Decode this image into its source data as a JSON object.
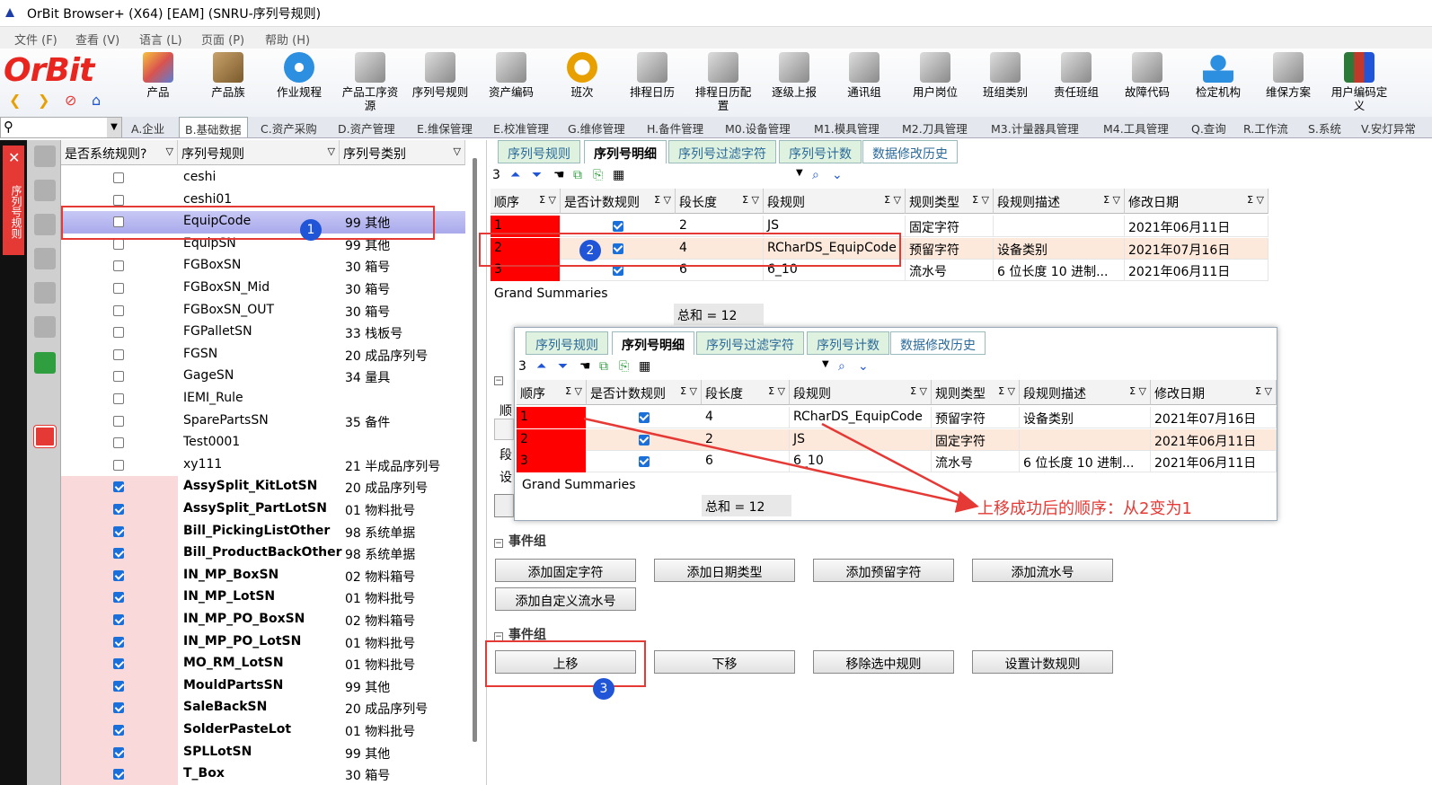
{
  "window": {
    "title": "OrBit Browser+ (X64) [EAM] (SNRU-序列号规则)"
  },
  "menu": [
    "文件 (F)",
    "查看 (V)",
    "语言 (L)",
    "页面 (P)",
    "帮助 (H)"
  ],
  "brand": "OrBit",
  "toolbar": [
    "产品",
    "产品族",
    "作业规程",
    "产品工序资源",
    "序列号规则",
    "资产编码",
    "班次",
    "排程日历",
    "排程日历配置",
    "逐级上报",
    "通讯组",
    "用户岗位",
    "班组类别",
    "责任班组",
    "故障代码",
    "检定机构",
    "维保方案",
    "用户编码定义"
  ],
  "module_tabs": [
    "A.企业",
    "B.基础数据",
    "C.资产采购",
    "D.资产管理",
    "E.维保管理",
    "E.校准管理",
    "G.维修管理",
    "H.备件管理",
    "M0.设备管理",
    "M1.模具管理",
    "M2.刀具管理",
    "M3.计量器具管理",
    "M4.工具管理",
    "Q.查询",
    "R.工作流",
    "S.系统",
    "V.安灯异常"
  ],
  "sidebar_label": "序列号规则",
  "left_grid": {
    "headers": [
      "是否系统规则?",
      "序列号规则",
      "序列号类别"
    ],
    "rows": [
      {
        "sys": false,
        "name": "ceshi",
        "cat": ""
      },
      {
        "sys": false,
        "name": "ceshi01",
        "cat": ""
      },
      {
        "sys": false,
        "name": "EquipCode",
        "cat": "99 其他",
        "selected": true
      },
      {
        "sys": false,
        "name": "EquipSN",
        "cat": "99 其他"
      },
      {
        "sys": false,
        "name": "FGBoxSN",
        "cat": "30 箱号"
      },
      {
        "sys": false,
        "name": "FGBoxSN_Mid",
        "cat": "30 箱号"
      },
      {
        "sys": false,
        "name": "FGBoxSN_OUT",
        "cat": "30 箱号"
      },
      {
        "sys": false,
        "name": "FGPalletSN",
        "cat": "33 栈板号"
      },
      {
        "sys": false,
        "name": "FGSN",
        "cat": "20 成品序列号"
      },
      {
        "sys": false,
        "name": "GageSN",
        "cat": "34 量具"
      },
      {
        "sys": false,
        "name": "IEMI_Rule",
        "cat": ""
      },
      {
        "sys": false,
        "name": "SparePartsSN",
        "cat": "35 备件"
      },
      {
        "sys": false,
        "name": "Test0001",
        "cat": ""
      },
      {
        "sys": false,
        "name": "xy111",
        "cat": "21 半成品序列号"
      },
      {
        "sys": true,
        "name": "AssySplit_KitLotSN",
        "cat": "20 成品序列号"
      },
      {
        "sys": true,
        "name": "AssySplit_PartLotSN",
        "cat": "01 物料批号"
      },
      {
        "sys": true,
        "name": "Bill_PickingListOther",
        "cat": "98 系统单据"
      },
      {
        "sys": true,
        "name": "Bill_ProductBackOther",
        "cat": "98 系统单据"
      },
      {
        "sys": true,
        "name": "IN_MP_BoxSN",
        "cat": "02 物料箱号"
      },
      {
        "sys": true,
        "name": "IN_MP_LotSN",
        "cat": "01 物料批号"
      },
      {
        "sys": true,
        "name": "IN_MP_PO_BoxSN",
        "cat": "02 物料箱号"
      },
      {
        "sys": true,
        "name": "IN_MP_PO_LotSN",
        "cat": "01 物料批号"
      },
      {
        "sys": true,
        "name": "MO_RM_LotSN",
        "cat": "01 物料批号"
      },
      {
        "sys": true,
        "name": "MouldPartsSN",
        "cat": "99 其他"
      },
      {
        "sys": true,
        "name": "SaleBackSN",
        "cat": "20 成品序列号"
      },
      {
        "sys": true,
        "name": "SolderPasteLot",
        "cat": "01 物料批号"
      },
      {
        "sys": true,
        "name": "SPLLotSN",
        "cat": "99 其他"
      },
      {
        "sys": true,
        "name": "T_Box",
        "cat": "30 箱号"
      }
    ]
  },
  "sub_tabs": [
    "序列号规则",
    "序列号明细",
    "序列号过滤字符",
    "序列号计数",
    "数据修改历史"
  ],
  "detail": {
    "count": "3",
    "headers": [
      "顺序",
      "是否计数规则",
      "段长度",
      "段规则",
      "规则类型",
      "段规则描述",
      "修改日期"
    ],
    "rows": [
      {
        "seq": "1",
        "len": "2",
        "rule": "JS",
        "type": "固定字符",
        "desc": "",
        "date": "2021年06月11日"
      },
      {
        "seq": "2",
        "len": "4",
        "rule": "RCharDS_EquipCode",
        "type": "预留字符",
        "desc": "设备类别",
        "date": "2021年07月16日"
      },
      {
        "seq": "3",
        "len": "6",
        "rule": "6_10",
        "type": "流水号",
        "desc": "6 位长度 10 进制...",
        "date": "2021年06月11日"
      }
    ],
    "summary_label": "Grand Summaries",
    "summary": "总和 = 12"
  },
  "popup_detail": {
    "count": "3",
    "rows": [
      {
        "seq": "1",
        "len": "4",
        "rule": "RCharDS_EquipCode",
        "type": "预留字符",
        "desc": "设备类别",
        "date": "2021年07月16日"
      },
      {
        "seq": "2",
        "len": "2",
        "rule": "JS",
        "type": "固定字符",
        "desc": "",
        "date": "2021年06月11日"
      },
      {
        "seq": "3",
        "len": "6",
        "rule": "6_10",
        "type": "流水号",
        "desc": "6 位长度 10 进制...",
        "date": "2021年06月11日"
      }
    ],
    "summary_label": "Grand Summaries",
    "summary": "总和 = 12"
  },
  "event_group_label": "事件组",
  "buttons1": [
    "添加固定字符",
    "添加日期类型",
    "添加预留字符",
    "添加流水号",
    "添加自定义流水号"
  ],
  "buttons2": [
    "上移",
    "下移",
    "移除选中规则",
    "设置计数规则"
  ],
  "partial_labels": [
    "顺",
    "段",
    "设"
  ],
  "annotation": "上移成功后的顺序：从2变为1",
  "badges": [
    "1",
    "2",
    "3"
  ],
  "colors": {
    "brand": "#e8251f",
    "highlight": "#e53935",
    "selected_row": "#fde9dc",
    "badge": "#1f55d6"
  }
}
